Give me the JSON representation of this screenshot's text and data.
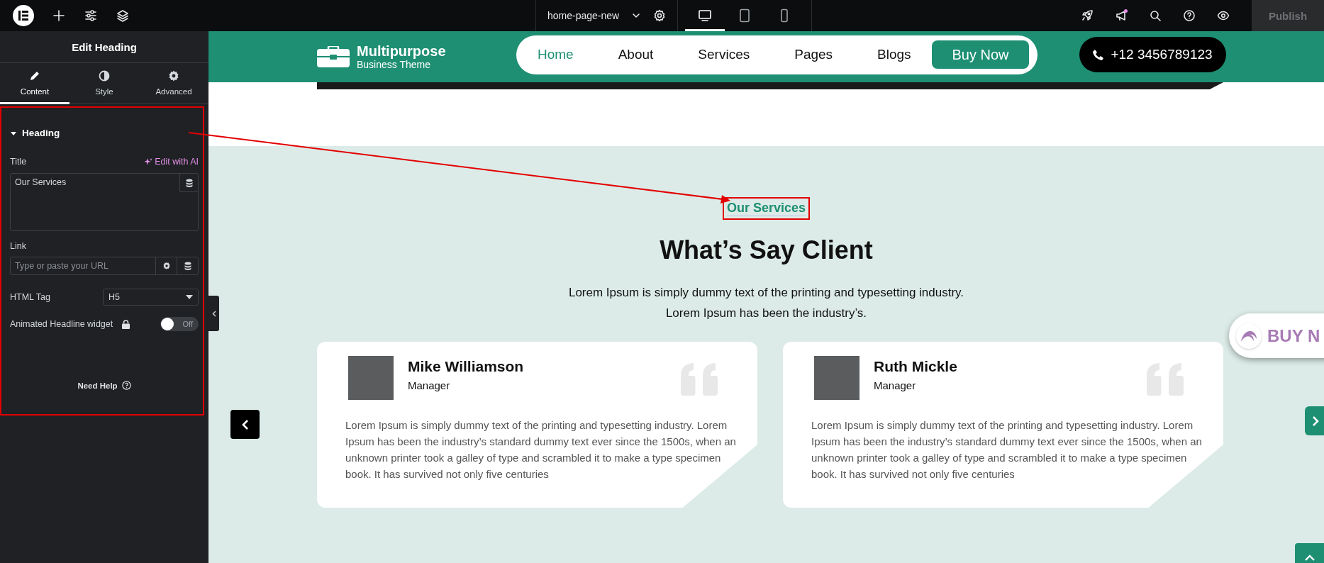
{
  "top_bar": {
    "page_name": "home-page-new",
    "devices": [
      {
        "kind": "desktop",
        "selected": true
      },
      {
        "kind": "tablet",
        "selected": false
      },
      {
        "kind": "mobile",
        "selected": false
      }
    ],
    "publish": {
      "label": "Publish",
      "disabled": true
    }
  },
  "panel": {
    "title": "Edit Heading",
    "tabs": [
      {
        "kind": "content",
        "label": "Content",
        "selected": true
      },
      {
        "kind": "style",
        "label": "Style",
        "selected": false
      },
      {
        "kind": "advanced",
        "label": "Advanced",
        "selected": false
      }
    ],
    "section": {
      "title": "Heading",
      "expanded": true
    },
    "title_field": {
      "label": "Title",
      "ai_link": "Edit with AI",
      "value": "Our Services"
    },
    "link_field": {
      "label": "Link",
      "placeholder": "Type or paste your URL"
    },
    "html_tag": {
      "label": "HTML Tag",
      "value": "H5"
    },
    "animated_headline": {
      "label": "Animated Headline widget",
      "on": false,
      "state_text": "Off"
    },
    "help": "Need Help"
  },
  "site": {
    "logo": {
      "name": "Multipurpose",
      "tagline": "Business Theme"
    },
    "nav": [
      {
        "label": "Home",
        "selected": true
      },
      {
        "label": "About",
        "selected": false
      },
      {
        "label": "Services",
        "selected": false
      },
      {
        "label": "Pages",
        "selected": false
      },
      {
        "label": "Blogs",
        "selected": false
      }
    ],
    "cta": "Buy Now",
    "phone": "+12 3456789123"
  },
  "testimonials": {
    "eyebrow": "Our Services",
    "heading": "What’s Say Client",
    "intro": [
      "Lorem Ipsum is simply dummy text of the printing and typesetting industry.",
      "Lorem Ipsum has been the industry’s."
    ],
    "cards": [
      {
        "name": "Mike Williamson",
        "role": "Manager",
        "text": "Lorem Ipsum is simply dummy text of the printing and typesetting industry. Lorem Ipsum has been the industry’s standard dummy text ever since the 1500s, when an unknown printer took a galley of type and scrambled it to make a type specimen book. It has survived not only five centuries"
      },
      {
        "name": "Ruth Mickle",
        "role": "Manager",
        "text": "Lorem Ipsum is simply dummy text of the printing and typesetting industry. Lorem Ipsum has been the industry’s standard dummy text ever since the 1500s, when an unknown printer took a galley of type and scrambled it to make a type specimen book. It has survived not only five centuries"
      }
    ]
  },
  "floating_badge": {
    "label": "BUY N"
  }
}
